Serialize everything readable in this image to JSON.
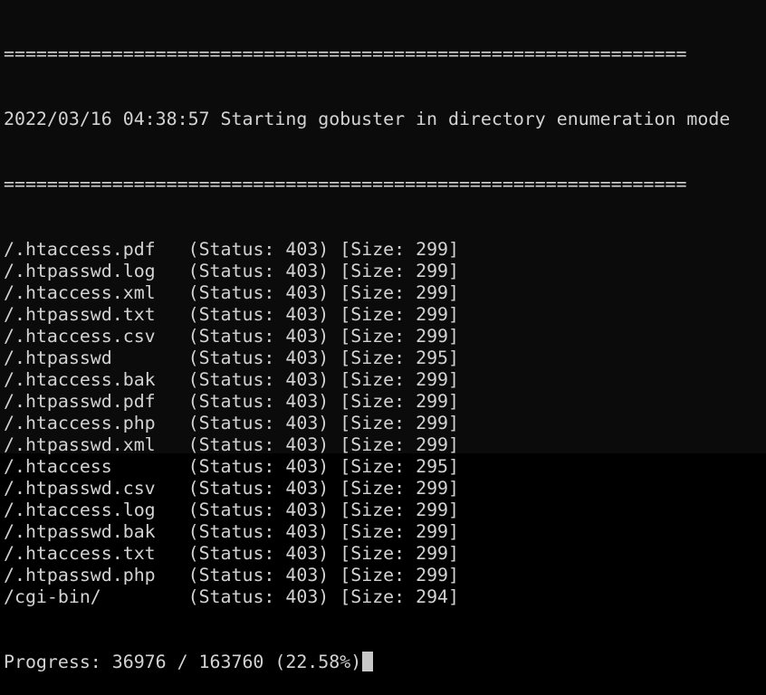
{
  "terminal": {
    "rule_top": "===============================================================",
    "start_message": "2022/03/16 04:38:57 Starting gobuster in directory enumeration mode",
    "rule_bottom": "===============================================================",
    "results": [
      {
        "path": "/.htaccess.pdf",
        "status": "(Status: 403)",
        "size": "[Size: 299]"
      },
      {
        "path": "/.htpasswd.log",
        "status": "(Status: 403)",
        "size": "[Size: 299]"
      },
      {
        "path": "/.htaccess.xml",
        "status": "(Status: 403)",
        "size": "[Size: 299]"
      },
      {
        "path": "/.htpasswd.txt",
        "status": "(Status: 403)",
        "size": "[Size: 299]"
      },
      {
        "path": "/.htaccess.csv",
        "status": "(Status: 403)",
        "size": "[Size: 299]"
      },
      {
        "path": "/.htpasswd",
        "status": "(Status: 403)",
        "size": "[Size: 295]"
      },
      {
        "path": "/.htaccess.bak",
        "status": "(Status: 403)",
        "size": "[Size: 299]"
      },
      {
        "path": "/.htpasswd.pdf",
        "status": "(Status: 403)",
        "size": "[Size: 299]"
      },
      {
        "path": "/.htaccess.php",
        "status": "(Status: 403)",
        "size": "[Size: 299]"
      },
      {
        "path": "/.htpasswd.xml",
        "status": "(Status: 403)",
        "size": "[Size: 299]"
      },
      {
        "path": "/.htaccess",
        "status": "(Status: 403)",
        "size": "[Size: 295]"
      },
      {
        "path": "/.htpasswd.csv",
        "status": "(Status: 403)",
        "size": "[Size: 299]"
      },
      {
        "path": "/.htaccess.log",
        "status": "(Status: 403)",
        "size": "[Size: 299]"
      },
      {
        "path": "/.htpasswd.bak",
        "status": "(Status: 403)",
        "size": "[Size: 299]"
      },
      {
        "path": "/.htaccess.txt",
        "status": "(Status: 403)",
        "size": "[Size: 299]"
      },
      {
        "path": "/.htpasswd.php",
        "status": "(Status: 403)",
        "size": "[Size: 299]"
      },
      {
        "path": "/cgi-bin/",
        "status": "(Status: 403)",
        "size": "[Size: 294]"
      }
    ],
    "progress_line": "Progress: 36976 / 163760 (22.58%)",
    "progress": {
      "done": 36976,
      "total": 163760,
      "percent": 22.58
    },
    "colors": {
      "background": "#0b0b0b",
      "text": "#d3d3d3",
      "cursor": "#c8c8c8"
    }
  }
}
